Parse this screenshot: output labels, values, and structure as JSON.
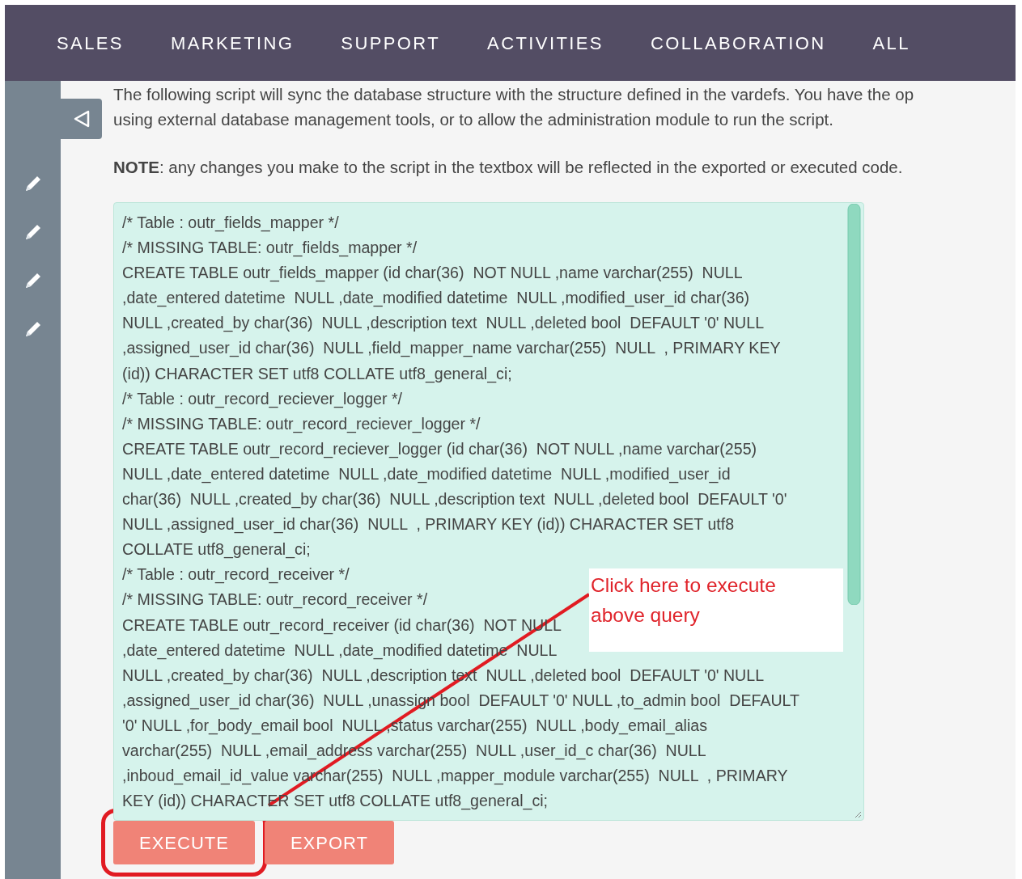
{
  "nav": {
    "items": [
      "SALES",
      "MARKETING",
      "SUPPORT",
      "ACTIVITIES",
      "COLLABORATION",
      "ALL"
    ]
  },
  "intro": [
    "The following script will sync the database structure with the structure defined in the vardefs. You have the op",
    "using external database management tools, or to allow the administration module to run the script."
  ],
  "note": "**NOTE**: any changes you make to the script in the textbox will be reflected in the exported or executed code.",
  "script_lines": [
    "/* Table : outr_fields_mapper */",
    "/* MISSING TABLE: outr_fields_mapper */",
    "CREATE TABLE outr_fields_mapper (id char(36)  NOT NULL ,name varchar(255)  NULL",
    ",date_entered datetime  NULL ,date_modified datetime  NULL ,modified_user_id char(36)",
    "NULL ,created_by char(36)  NULL ,description text  NULL ,deleted bool  DEFAULT '0' NULL",
    ",assigned_user_id char(36)  NULL ,field_mapper_name varchar(255)  NULL  , PRIMARY KEY",
    "(id)) CHARACTER SET utf8 COLLATE utf8_general_ci;",
    "/* Table : outr_record_reciever_logger */",
    "/* MISSING TABLE: outr_record_reciever_logger */",
    "CREATE TABLE outr_record_reciever_logger (id char(36)  NOT NULL ,name varchar(255)",
    "NULL ,date_entered datetime  NULL ,date_modified datetime  NULL ,modified_user_id",
    "char(36)  NULL ,created_by char(36)  NULL ,description text  NULL ,deleted bool  DEFAULT '0'",
    "NULL ,assigned_user_id char(36)  NULL  , PRIMARY KEY (id)) CHARACTER SET utf8",
    "COLLATE utf8_general_ci;",
    "/* Table : outr_record_receiver */",
    "/* MISSING TABLE: outr_record_receiver */",
    "CREATE TABLE outr_record_receiver (id char(36)  NOT NULL",
    ",date_entered datetime  NULL ,date_modified datetime  NULL",
    "NULL ,created_by char(36)  NULL ,description text  NULL ,deleted bool  DEFAULT '0' NULL",
    ",assigned_user_id char(36)  NULL ,unassign bool  DEFAULT '0' NULL ,to_admin bool  DEFAULT",
    "'0' NULL ,for_body_email bool  NULL ,status varchar(255)  NULL ,body_email_alias",
    "varchar(255)  NULL ,email_address varchar(255)  NULL ,user_id_c char(36)  NULL",
    ",inboud_email_id_value varchar(255)  NULL ,mapper_module varchar(255)  NULL  , PRIMARY",
    "KEY (id)) CHARACTER SET utf8 COLLATE utf8_general_ci;"
  ],
  "buttons": [
    {
      "label": "EXECUTE",
      "highlighted": true
    },
    {
      "label": "EXPORT",
      "highlighted": false
    }
  ],
  "annotation": {
    "text": "Click here to execute above query"
  }
}
